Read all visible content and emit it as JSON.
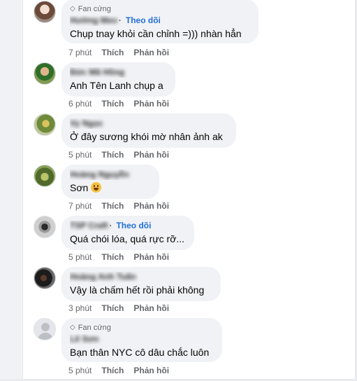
{
  "comments": [
    {
      "badge": "Fan cứng",
      "name": "Hường Meo",
      "follow": "Theo dõi",
      "text": "Chụp tnay khỏi cần chỉnh =))) nhàn hẳn",
      "time": "7 phút",
      "like": "Thích",
      "reply": "Phản hồi"
    },
    {
      "name": "Đức Mã Hồng",
      "text": "Anh Tên Lanh chụp a",
      "time": "6 phút",
      "like": "Thích",
      "reply": "Phản hồi"
    },
    {
      "name": "Vy Ngọc",
      "text": "Ở đây sương khói mờ nhân ảnh ak",
      "time": "5 phút",
      "like": "Thích",
      "reply": "Phản hồi"
    },
    {
      "name": "Hoàng Nguyễn",
      "text": "Sơn",
      "emoji": "grinning-face",
      "time": "7 phút",
      "like": "Thích",
      "reply": "Phản hồi"
    },
    {
      "name": "TSP Craft",
      "follow": "Theo dõi",
      "text": "Quá chói lóa, quá rực rỡ...",
      "time": "5 phút",
      "like": "Thích",
      "reply": "Phản hồi"
    },
    {
      "name": "Hoàng Anh Tuấn",
      "text": "Vậy là chấm hết rồi phải không",
      "time": "3 phút",
      "like": "Thích",
      "reply": "Phản hồi"
    },
    {
      "badge": "Fan cứng",
      "name": "Lê Sơn",
      "text": "Bạn thân NYC cô dâu chắc luôn",
      "time": "5 phút",
      "like": "Thích",
      "reply": "Phản hồi"
    }
  ],
  "colors": {
    "bubble": "#f0f2f5",
    "link": "#216fdb",
    "meta": "#65676b"
  }
}
